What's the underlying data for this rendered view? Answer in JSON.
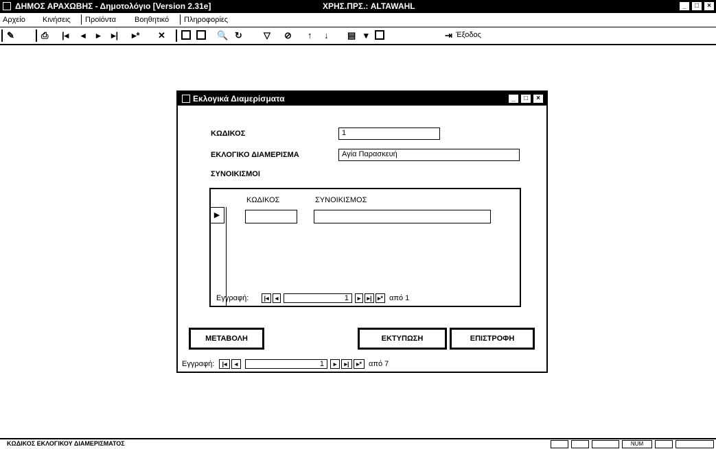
{
  "app": {
    "title": "ΔΗΜΟΣ ΑΡΑΧΩΒΗΣ - Δημοτολόγιο [Version 2.31e]",
    "user": "ΧΡΗΣ.ΠΡΣ.: ALTAWAHL",
    "window_buttons": [
      "_",
      "□",
      "×"
    ]
  },
  "menu": {
    "items": [
      "Αρχείο",
      "Κινήσεις",
      "Προϊόντα",
      "Βοηθητικό",
      "Πληροφορίες"
    ]
  },
  "toolbar": {
    "exit_label": "Έξοδος"
  },
  "dialog": {
    "title": "Εκλογικά Διαμερίσματα",
    "buttons": [
      "_",
      "□",
      "×"
    ],
    "code_label": "ΚΩΔΙΚΟΣ",
    "code_value": "1",
    "district_label": "ΕΚΛΟΓΙΚΟ ΔΙΑΜΕΡΙΣΜΑ",
    "district_value": "Αγία Παρασκευή",
    "settlements_label": "ΣΥΝΟΙΚΙΣΜΟΙ",
    "subform": {
      "col_code": "ΚΩΔΙΚΟΣ",
      "col_name": "ΣΥΝΟΙΚΙΣΜΟΣ",
      "nav_label": "Εγγραφή:",
      "record_number": "1",
      "record_total": "από 1"
    },
    "change_button": "ΜΕΤΑΒΟΛΗ",
    "print_button": "ΕΚΤΥΠΩΣΗ",
    "return_button": "ΕΠΙΣΤΡΟΦΗ",
    "nav": {
      "label": "Εγγραφή:",
      "record_number": "1",
      "record_total": "από 7"
    }
  },
  "status": {
    "text": "ΚΩΔΙΚΟΣ ΕΚΛΟΓΙΚΟΥ ΔΙΑΜΕΡΙΣΜΑΤΟΣ",
    "indicator": "NUM"
  }
}
